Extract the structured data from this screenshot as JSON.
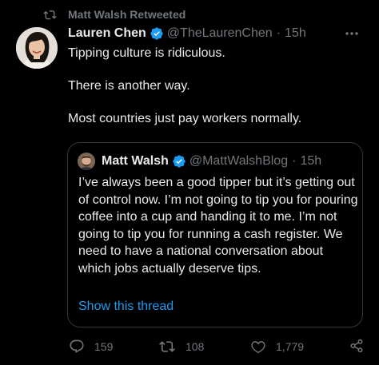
{
  "retweet_banner": {
    "icon": "retweet-icon",
    "text": "Matt Walsh Retweeted"
  },
  "tweet": {
    "author": {
      "display_name": "Lauren Chen",
      "handle": "@TheLaurenChen",
      "verified": true
    },
    "separator": "·",
    "time": "15h",
    "paragraphs": [
      "Tipping culture is ridiculous.",
      "There is another way.",
      "Most countries just pay workers normally."
    ],
    "more_icon": "more-horizontal-icon"
  },
  "quoted_tweet": {
    "author": {
      "display_name": "Matt Walsh",
      "handle": "@MattWalshBlog",
      "verified": true
    },
    "separator": "·",
    "time": "15h",
    "body": "I’ve always been a good tipper but it’s getting out of control now. I’m not going to tip you for pouring coffee into a cup and handing it to me. I’m not going to tip you for running a cash register. We need to have a national conversation about which jobs actually deserve tips.",
    "show_thread_label": "Show this thread"
  },
  "actions": {
    "reply_count": "159",
    "retweet_count": "108",
    "like_count": "1,779",
    "reply_icon": "reply-icon",
    "retweet_icon": "retweet-icon",
    "like_icon": "heart-icon",
    "share_icon": "share-icon"
  },
  "colors": {
    "background": "#000000",
    "primary_text": "#e7e9ea",
    "secondary_text": "#71767b",
    "link": "#1d9bf0",
    "verified_badge": "#1d9bf0",
    "border": "#333639"
  }
}
